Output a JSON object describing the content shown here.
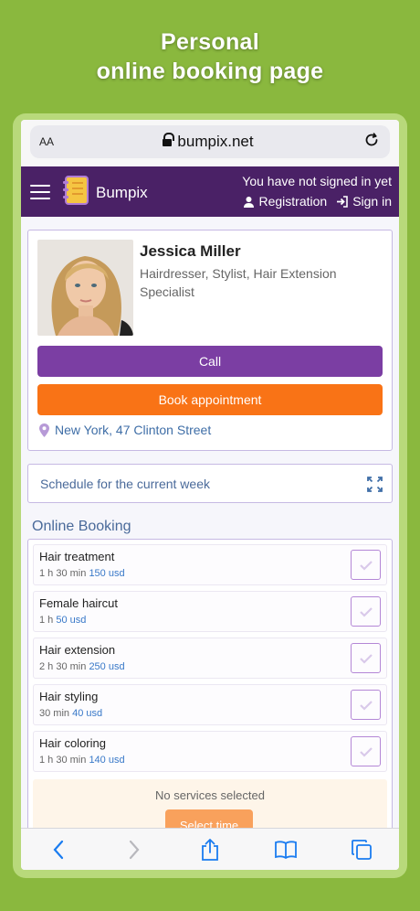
{
  "headline": {
    "line1": "Personal",
    "line2": "online booking page"
  },
  "browser": {
    "text_size_label": "AA",
    "url": "bumpix.net"
  },
  "nav": {
    "brand": "Bumpix",
    "not_signed": "You have not signed in yet",
    "registration": "Registration",
    "sign_in": "Sign in"
  },
  "profile": {
    "name": "Jessica Miller",
    "role": "Hairdresser, Stylist, Hair Extension Specialist",
    "call_label": "Call",
    "book_label": "Book appointment",
    "address": "New York, 47 Clinton Street"
  },
  "schedule": {
    "label": "Schedule for the current week"
  },
  "booking": {
    "title": "Online Booking",
    "services": [
      {
        "name": "Hair treatment",
        "duration": "1 h 30 min",
        "price": "150 usd"
      },
      {
        "name": "Female haircut",
        "duration": "1 h",
        "price": "50 usd"
      },
      {
        "name": "Hair extension",
        "duration": "2 h 30 min",
        "price": "250 usd"
      },
      {
        "name": "Hair styling",
        "duration": "30 min",
        "price": "40 usd"
      },
      {
        "name": "Hair coloring",
        "duration": "1 h 30 min",
        "price": "140 usd"
      }
    ],
    "no_services": "No services selected",
    "select_time": "Select time"
  },
  "colors": {
    "background": "#8ab83e",
    "navbar": "#4a2166",
    "call": "#7b3ea3",
    "book": "#f97316",
    "link": "#3f6ea7",
    "ios_blue": "#1a7cf0"
  },
  "toolbar_icons": [
    "back-icon",
    "forward-icon",
    "share-icon",
    "bookmarks-icon",
    "tabs-icon"
  ]
}
